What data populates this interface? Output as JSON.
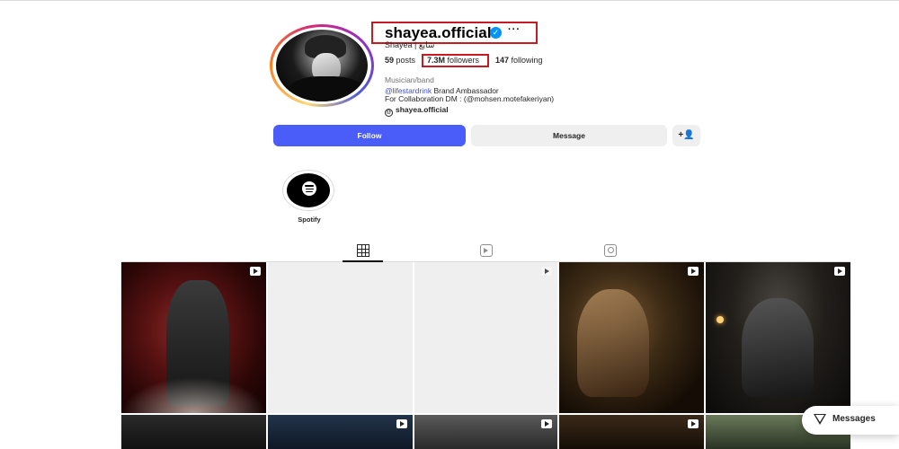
{
  "profile": {
    "username": "shayea.official",
    "verified_icon": "verified-badge-icon",
    "more_icon": "ellipsis-icon",
    "more_label": "···",
    "full_name": "Shayea | شایع",
    "stats": {
      "posts_value": "59",
      "posts_label": "posts",
      "followers_value": "7.3M",
      "followers_label": "followers",
      "following_value": "147",
      "following_label": "following"
    },
    "category": "Musician/band",
    "bio_mention": "@lifestardrink",
    "bio_line1_rest": " Brand Ambassador",
    "bio_line2": "For Collaboration DM : (@mohsen.motefakeriyan)",
    "threads_handle": "shayea.official",
    "threads_icon": "threads-icon"
  },
  "actions": {
    "follow_label": "Follow",
    "message_label": "Message",
    "suggest_icon": "add-person-icon",
    "suggest_label": "+👤"
  },
  "highlights": [
    {
      "label": "Spotify",
      "icon": "spotify-icon"
    }
  ],
  "tabs": [
    {
      "name": "posts",
      "icon": "grid-icon",
      "active": true
    },
    {
      "name": "reels",
      "icon": "reels-icon",
      "active": false
    },
    {
      "name": "tagged",
      "icon": "tagged-icon",
      "active": false
    }
  ],
  "posts": [
    {
      "type": "reel",
      "icon": "reel-icon"
    },
    {
      "type": "loading"
    },
    {
      "type": "reel-loading",
      "icon": "reel-icon"
    },
    {
      "type": "reel",
      "icon": "reel-icon"
    },
    {
      "type": "reel",
      "icon": "reel-icon"
    },
    {
      "type": "image"
    },
    {
      "type": "reel",
      "icon": "reel-icon"
    },
    {
      "type": "reel",
      "icon": "reel-icon"
    },
    {
      "type": "reel",
      "icon": "reel-icon"
    },
    {
      "type": "image"
    }
  ],
  "messages": {
    "label": "Messages",
    "icon": "send-icon"
  },
  "colors": {
    "follow_button": "#4a5df9",
    "highlight_box": "#c61b24",
    "verified": "#0095f6",
    "mention_link": "#4250b7"
  }
}
